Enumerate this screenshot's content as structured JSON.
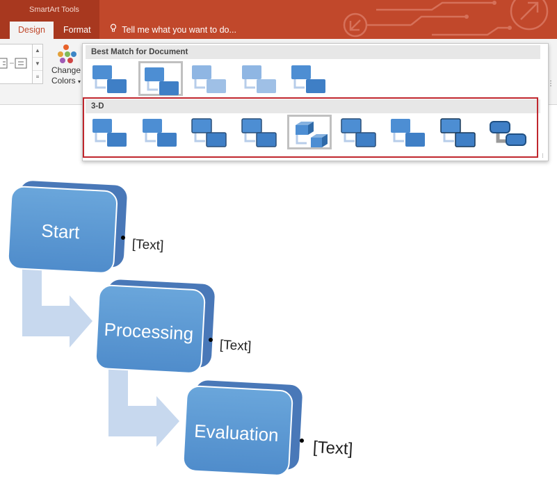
{
  "ribbon": {
    "context_group": "SmartArt Tools",
    "tabs": [
      {
        "label": "Design",
        "active": true
      },
      {
        "label": "Format",
        "active": false
      }
    ],
    "tell_me": "Tell me what you want to do...",
    "change_colors_label_1": "Change",
    "change_colors_label_2": "Colors",
    "accent_color": "#c1482b"
  },
  "gallery": {
    "section_best_match": "Best Match for Document",
    "section_3d": "3-D",
    "best_match_count": 5,
    "best_match_selected_index": 1,
    "three_d_count": 9,
    "three_d_selected_index": 4
  },
  "diagram": {
    "steps": [
      {
        "label": "Start",
        "note": "[Text]"
      },
      {
        "label": "Processing",
        "note": "[Text]"
      },
      {
        "label": "Evaluation",
        "note": "[Text]"
      }
    ],
    "box_color": "#5b9bd5",
    "arrow_color": "#c5d7ee"
  }
}
